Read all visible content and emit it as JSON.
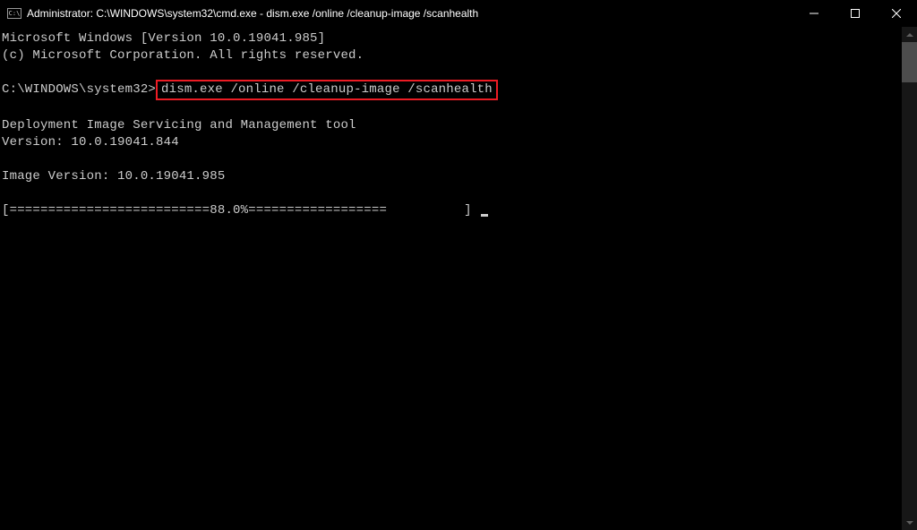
{
  "titlebar": {
    "icon_label": "C:\\",
    "title": "Administrator: C:\\WINDOWS\\system32\\cmd.exe - dism.exe  /online /cleanup-image /scanhealth"
  },
  "console": {
    "line1": "Microsoft Windows [Version 10.0.19041.985]",
    "line2": "(c) Microsoft Corporation. All rights reserved.",
    "blank1": "",
    "prompt_path": "C:\\WINDOWS\\system32>",
    "command": "dism.exe /online /cleanup-image /scanhealth",
    "blank2": "",
    "tool_line": "Deployment Image Servicing and Management tool",
    "version_line": "Version: 10.0.19041.844",
    "blank3": "",
    "image_version": "Image Version: 10.0.19041.985",
    "blank4": "",
    "progress": "[==========================88.0%==================          ] "
  }
}
